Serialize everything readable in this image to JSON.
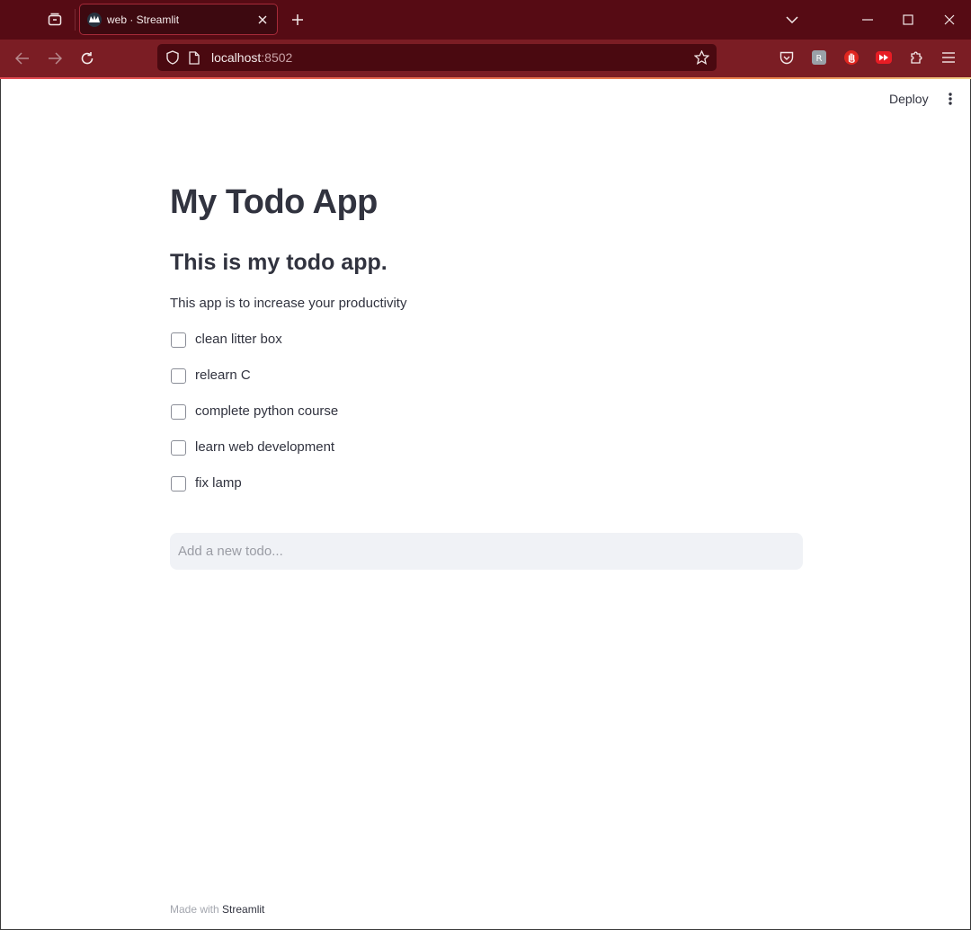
{
  "browser": {
    "tab_title": "web · Streamlit",
    "url_host": "localhost",
    "url_port": ":8502",
    "colors": {
      "tabbar": "#560b14",
      "toolbar": "#7b1d24",
      "urlbar": "#4a0910"
    }
  },
  "header": {
    "deploy_label": "Deploy"
  },
  "main": {
    "title": "My Todo App",
    "subtitle": "This is my todo app.",
    "description": "This app is to increase your productivity",
    "todos": [
      {
        "label": "clean litter box",
        "checked": false
      },
      {
        "label": "relearn C",
        "checked": false
      },
      {
        "label": "complete python course",
        "checked": false
      },
      {
        "label": "learn web development",
        "checked": false
      },
      {
        "label": "fix lamp",
        "checked": false
      }
    ],
    "new_todo": {
      "value": "",
      "placeholder": "Add a new todo..."
    }
  },
  "footer": {
    "prefix": "Made with",
    "link": "Streamlit"
  }
}
